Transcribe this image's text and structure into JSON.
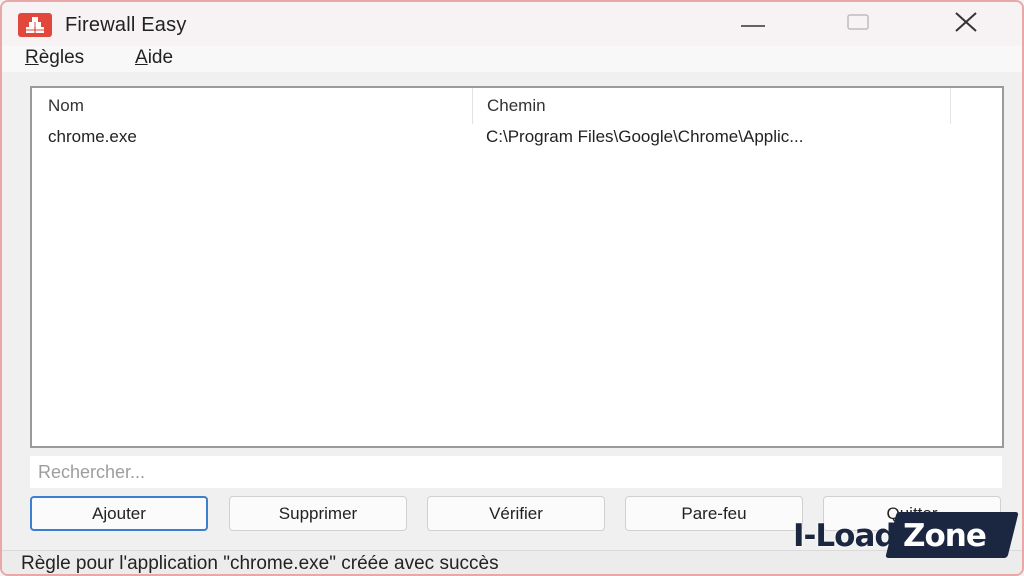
{
  "window": {
    "title": "Firewall Easy",
    "accent_color": "#e2473b",
    "icon": "brick-wall-icon",
    "controls": {
      "minimize": "minimize-icon",
      "maximize": "maximize-icon",
      "close": "close-icon"
    }
  },
  "menu": {
    "items": [
      {
        "label": "Règles"
      },
      {
        "label": "Aide"
      }
    ]
  },
  "table": {
    "columns": [
      "Nom",
      "Chemin"
    ],
    "rows": [
      {
        "nom": "chrome.exe",
        "chemin": "C:\\Program Files\\Google\\Chrome\\Applic..."
      }
    ]
  },
  "search": {
    "value": "",
    "placeholder": "Rechercher..."
  },
  "buttons": {
    "ajouter": "Ajouter",
    "supprimer": "Supprimer",
    "verifier": "Vérifier",
    "parefeu": "Pare-feu",
    "quitter": "Quitter"
  },
  "status": {
    "text": "Règle pour l'application \"chrome.exe\" créée avec succès"
  },
  "watermark": {
    "left": "I-Load",
    "right": "Zone"
  }
}
